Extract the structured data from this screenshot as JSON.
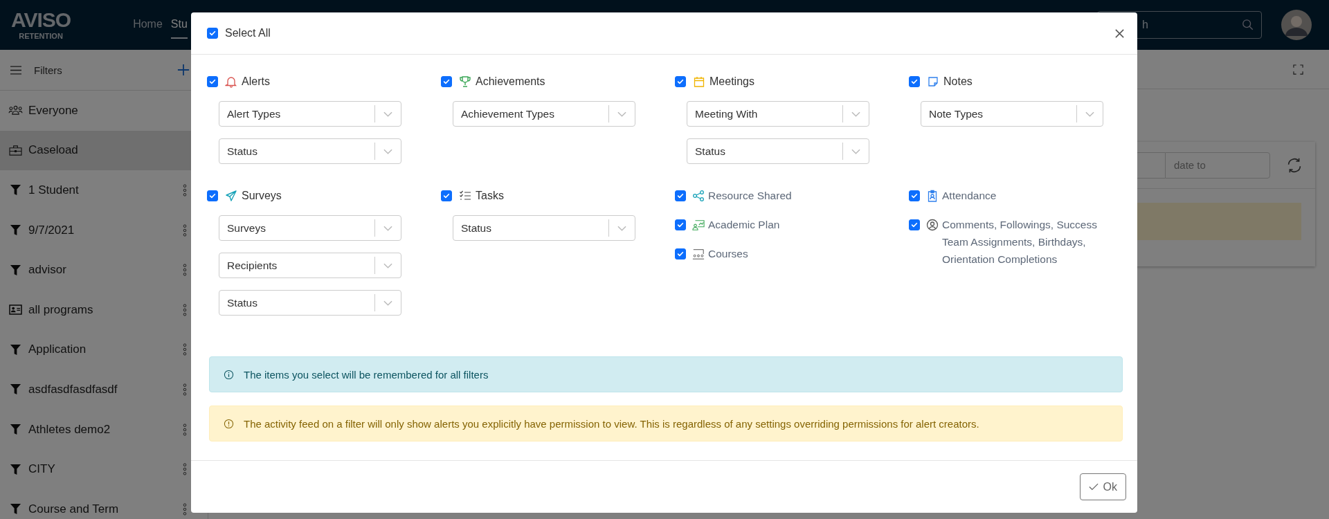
{
  "header": {
    "logo": {
      "title": "AVISO",
      "subtitle": "RETENTION"
    },
    "nav": [
      {
        "label": "Home",
        "selected": false
      },
      {
        "label": "Stu",
        "selected": true
      }
    ],
    "search": {
      "placeholder": "h"
    }
  },
  "sidebar": {
    "title": "Filters",
    "items": [
      {
        "label": "Everyone",
        "kind": "everyone",
        "selected": false
      },
      {
        "label": "Caseload",
        "kind": "caseload",
        "selected": true
      },
      {
        "label": "1 Student",
        "kind": "filter",
        "selected": false
      },
      {
        "label": "9/7/2021",
        "kind": "filter",
        "selected": false
      },
      {
        "label": "advisor",
        "kind": "filter",
        "selected": false
      },
      {
        "label": "all programs",
        "kind": "card",
        "selected": false
      },
      {
        "label": "Application",
        "kind": "filter",
        "selected": false
      },
      {
        "label": "asdfasdfasdfasdf",
        "kind": "filter",
        "selected": false
      },
      {
        "label": "Athletes demo2",
        "kind": "filter",
        "selected": false
      },
      {
        "label": "CITY",
        "kind": "filter",
        "selected": false
      },
      {
        "label": "Course and Term",
        "kind": "filter",
        "selected": false
      }
    ]
  },
  "main": {
    "date_to": {
      "placeholder": "date to"
    }
  },
  "modal": {
    "select_all": {
      "label": "Select All",
      "checked": true
    },
    "groups": [
      {
        "items": [
          {
            "label": "Alerts",
            "kind": "bell",
            "checked": true,
            "selects": [
              "Alert Types",
              "Status"
            ]
          }
        ]
      },
      {
        "items": [
          {
            "label": "Achievements",
            "kind": "trophy",
            "checked": true,
            "selects": [
              "Achievement Types"
            ]
          }
        ]
      },
      {
        "items": [
          {
            "label": "Meetings",
            "kind": "calendar",
            "checked": true,
            "selects": [
              "Meeting With",
              "Status"
            ]
          }
        ]
      },
      {
        "items": [
          {
            "label": "Notes",
            "kind": "note",
            "checked": true,
            "selects": [
              "Note Types"
            ]
          }
        ]
      },
      {
        "items": [
          {
            "label": "Surveys",
            "kind": "plane",
            "checked": true,
            "selects": [
              "Surveys",
              "Recipients",
              "Status"
            ]
          }
        ]
      },
      {
        "items": [
          {
            "label": "Tasks",
            "kind": "tasks",
            "checked": true,
            "selects": [
              "Status"
            ]
          }
        ]
      },
      {
        "items": [
          {
            "label": "Resource Shared",
            "kind": "share",
            "checked": true
          },
          {
            "label": "Academic Plan",
            "kind": "plan",
            "checked": true
          },
          {
            "label": "Courses",
            "kind": "courses",
            "checked": true
          }
        ]
      },
      {
        "items": [
          {
            "label": "Attendance",
            "kind": "badge",
            "checked": true
          },
          {
            "label": "Comments, Followings, Success Team Assignments, Birthdays, Orientation Completions",
            "kind": "person",
            "checked": true
          }
        ]
      }
    ],
    "info": "The items you select will be remembered for all filters",
    "warning": "The activity feed on a filter will only show alerts you explicitly have permission to view. This is regardless of any settings overriding permissions for alert creators.",
    "ok_button": "Ok"
  }
}
